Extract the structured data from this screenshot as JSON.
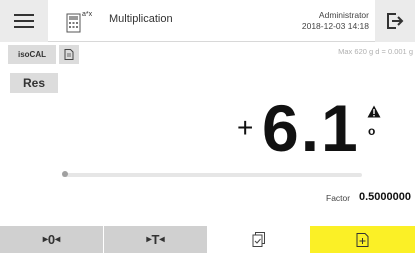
{
  "header": {
    "menu_icon": "hamburger-menu-icon",
    "app_icon": "multiplication-app-icon",
    "app_icon_text": "a*x",
    "title": "Multiplication",
    "user": "Administrator",
    "datetime": "2018-12-03  14:18",
    "logout_icon": "logout-icon"
  },
  "status": {
    "isocal_label": "isoCAL",
    "doc_icon": "document-icon",
    "range": "Max 620 g  d = 0.001 g"
  },
  "result": {
    "res_label": "Res"
  },
  "display": {
    "sign": "+",
    "value": "6.1",
    "unit": "o",
    "warning_icon": "warning-icon"
  },
  "progress": {
    "fraction": 0.0
  },
  "factor": {
    "label": "Factor",
    "value": "0.5000000"
  },
  "bottom": {
    "zero_label": "0",
    "tare_label": "T",
    "print_icon": "print-data-icon",
    "add_icon": "add-document-icon"
  },
  "colors": {
    "accent_yellow": "#fbf026",
    "button_gray": "#d0d0d0",
    "chip_gray": "#dcdcdc"
  }
}
